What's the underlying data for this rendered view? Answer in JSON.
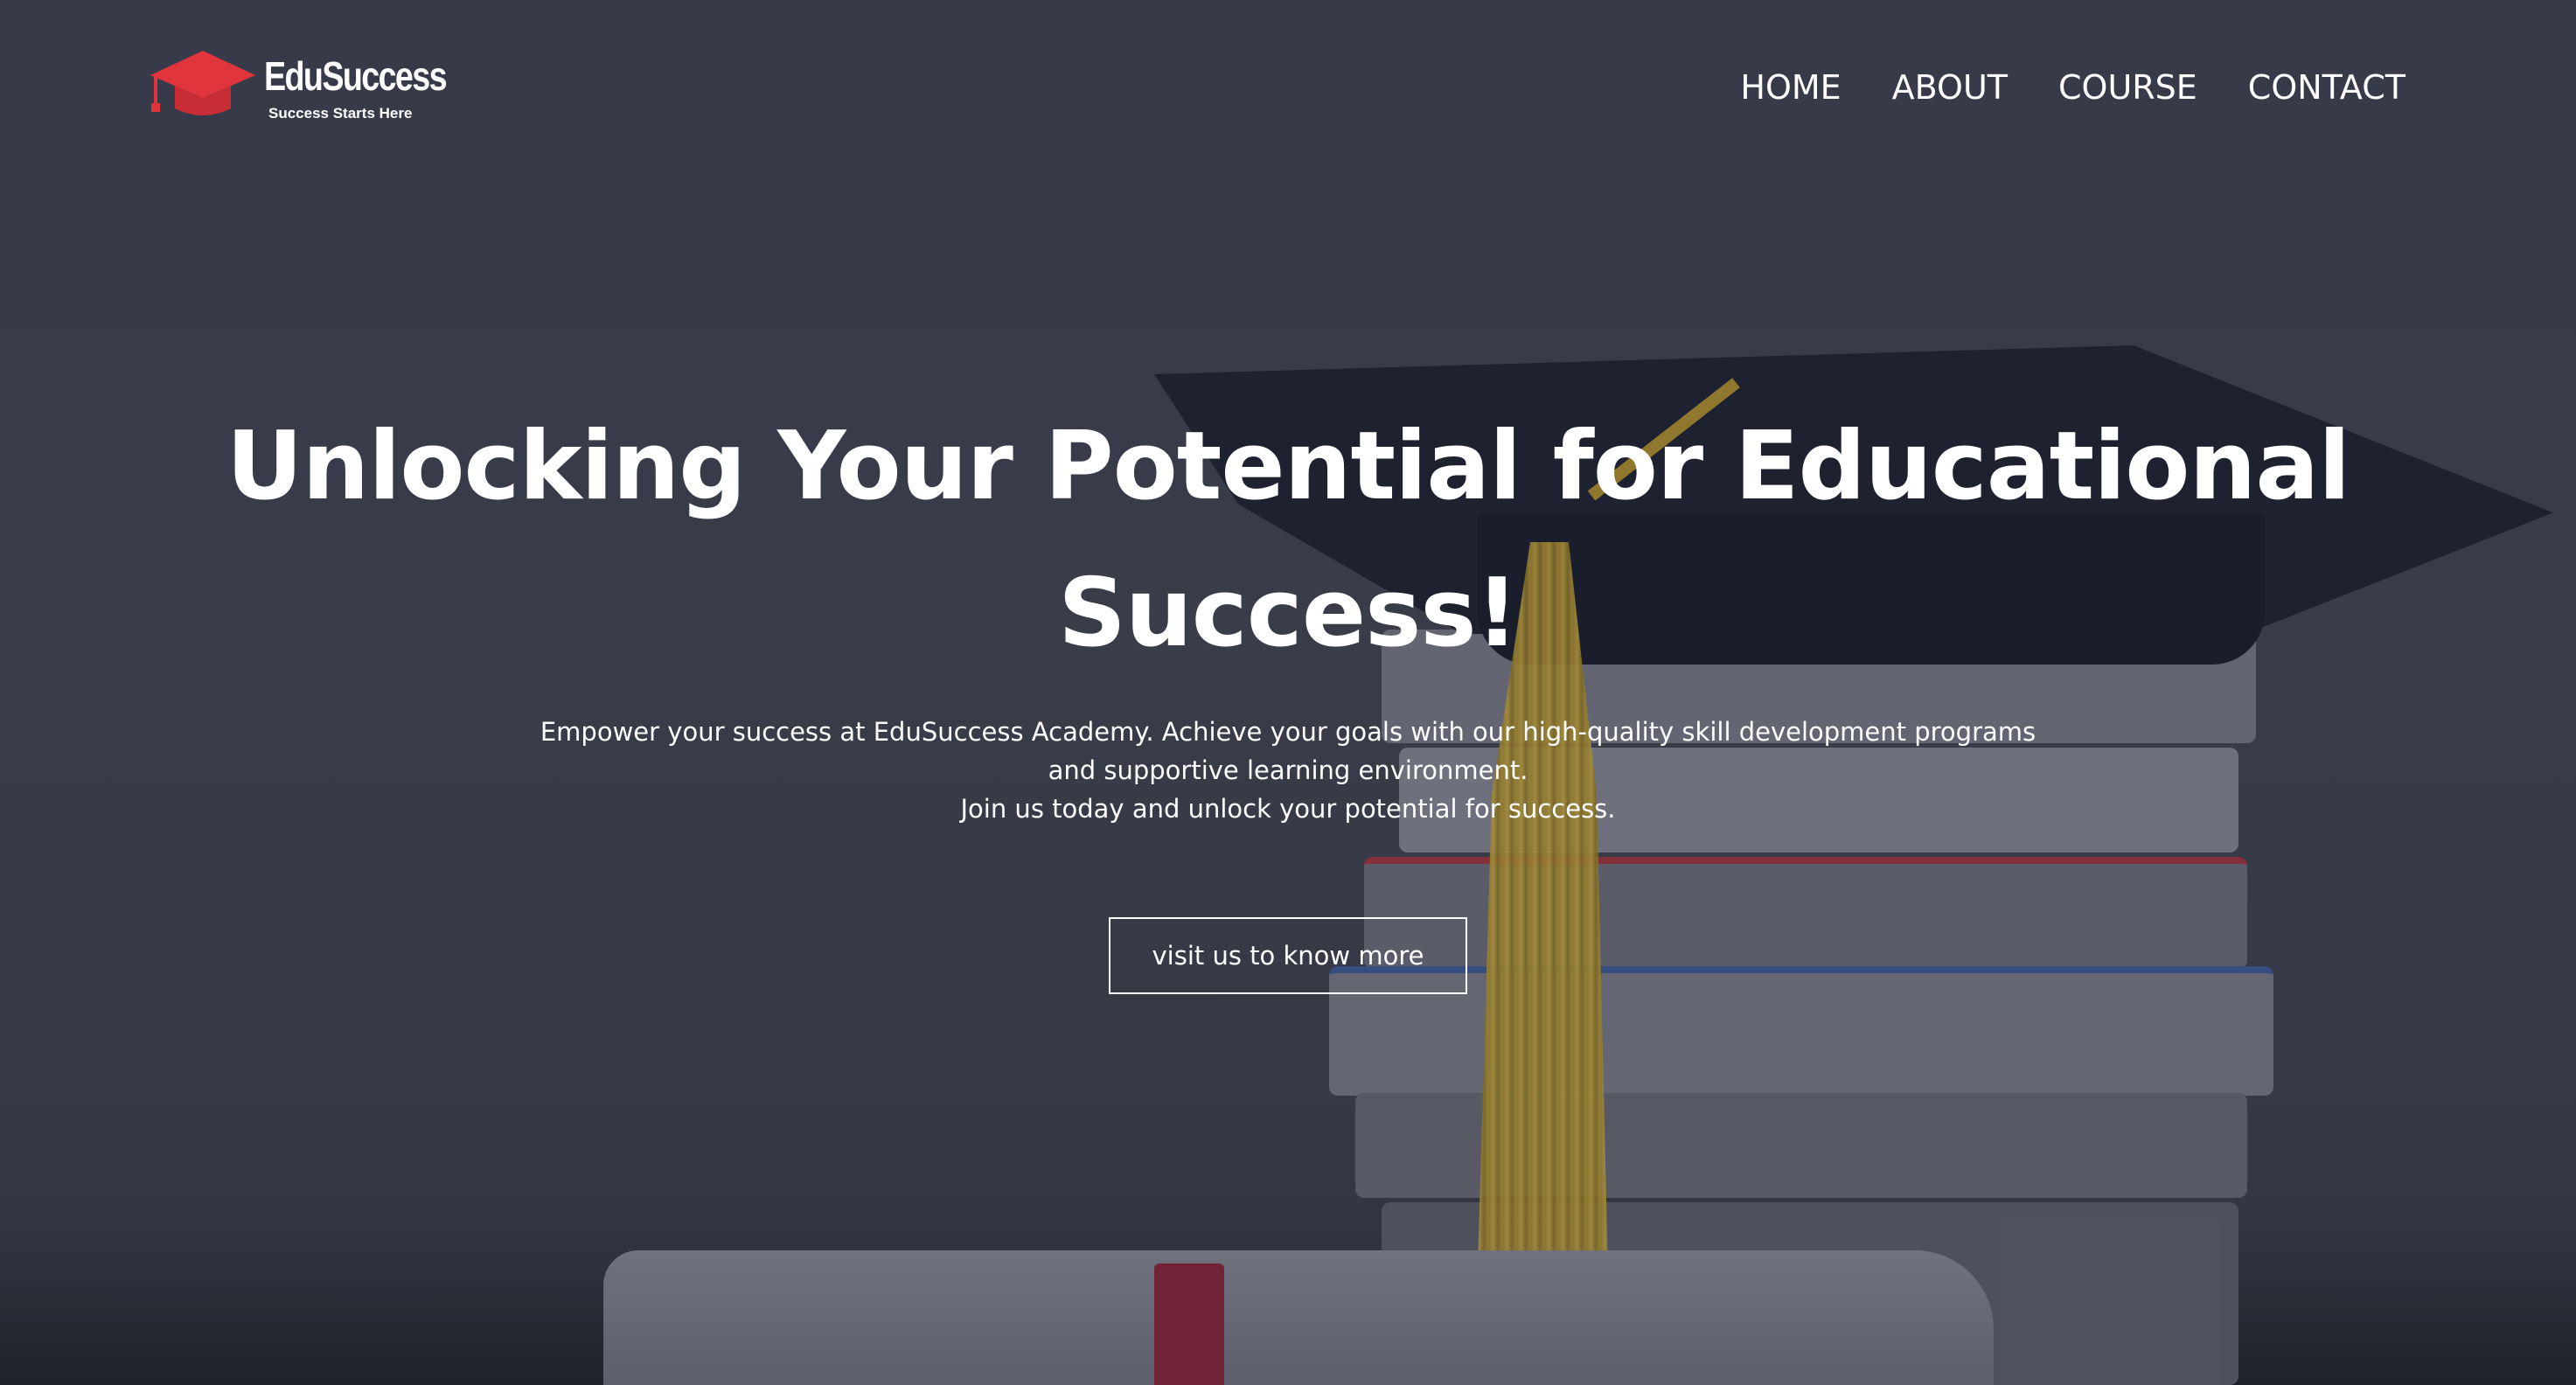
{
  "brand": {
    "name": "EduSuccess",
    "tagline": "Success Starts Here",
    "icon": "graduation-cap-icon",
    "accent_color": "#e0353d"
  },
  "nav": {
    "items": [
      "HOME",
      "ABOUT",
      "COURSE",
      "CONTACT"
    ]
  },
  "hero": {
    "headline_line1": "Unlocking Your Potential for Educational",
    "headline_line2": "Success!",
    "description_line1": "Empower your success at EduSuccess Academy. Achieve your goals with our high-quality skill development programs",
    "description_line2": "and supportive learning environment.",
    "description_line3": "Join us today and unlock your potential for success.",
    "cta_label": "visit us to know more",
    "background_image": "graduation cap with tassel on stack of books and rolled diploma"
  },
  "colors": {
    "overlay": "#3d4050",
    "text": "#ffffff"
  }
}
